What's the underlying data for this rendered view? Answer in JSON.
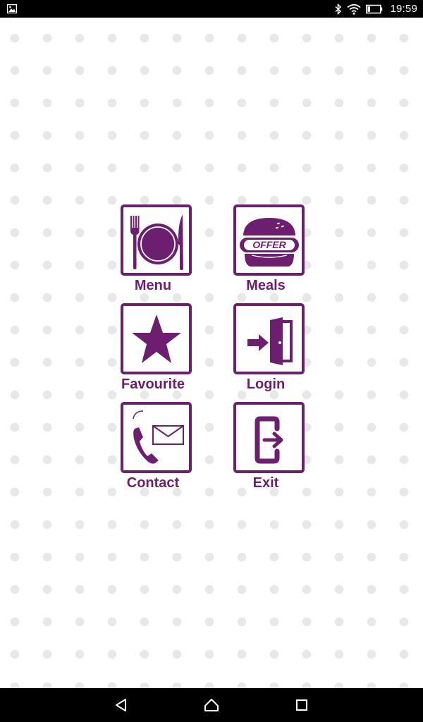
{
  "status_bar": {
    "time": "19:59",
    "icons": [
      "image-notification-icon",
      "bluetooth-icon",
      "wifi-icon",
      "battery-icon"
    ]
  },
  "tiles": [
    {
      "label": "Menu",
      "icon": "cutlery-plate-icon"
    },
    {
      "label": "Meals",
      "icon": "burger-offer-icon",
      "badge_text": "OFFER"
    },
    {
      "label": "Favourite",
      "icon": "star-icon"
    },
    {
      "label": "Login",
      "icon": "login-door-icon"
    },
    {
      "label": "Contact",
      "icon": "phone-mail-icon"
    },
    {
      "label": "Exit",
      "icon": "exit-icon"
    }
  ],
  "nav_bar": {
    "buttons": [
      "back-icon",
      "home-icon",
      "recents-icon"
    ]
  },
  "colors": {
    "accent": "#6b1f6e",
    "background": "#ffffff",
    "dots": "#e8e8e8",
    "bars": "#000000"
  }
}
